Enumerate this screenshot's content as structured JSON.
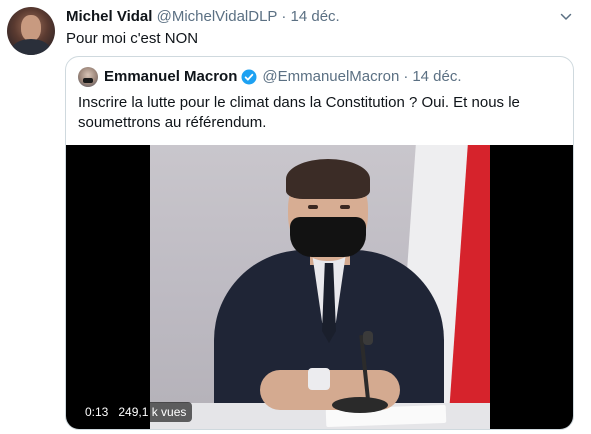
{
  "tweet": {
    "author_name": "Michel Vidal",
    "author_handle": "@MichelVidalDLP",
    "separator": "·",
    "date": "14 déc.",
    "text": "Pour moi c'est NON",
    "more_icon": "more-icon"
  },
  "quoted_tweet": {
    "author_name": "Emmanuel Macron",
    "author_handle": "@EmmanuelMacron",
    "separator": "·",
    "date": "14 déc.",
    "verified": true,
    "text": "Inscrire la lutte pour le climat dans la Constitution ? Oui. Et nous le soumettrons au référendum.",
    "video": {
      "timestamp": "0:13",
      "views": "249,1 k vues"
    }
  },
  "colors": {
    "accent": "#1da1f2",
    "secondary_text": "#5b7083",
    "border": "#cfd9de"
  }
}
